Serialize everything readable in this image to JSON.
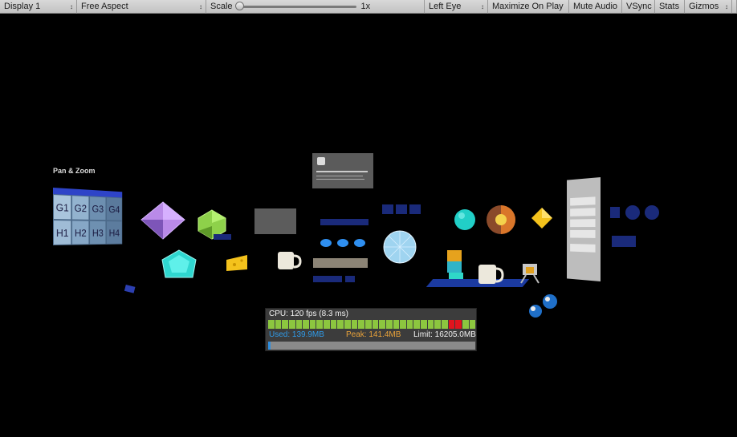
{
  "toolbar": {
    "display": "Display 1",
    "aspect": "Free Aspect",
    "scale_label": "Scale",
    "scale_value": "1x",
    "eye": "Left Eye",
    "maximize": "Maximize On Play",
    "mute": "Mute Audio",
    "vsync": "VSync",
    "stats": "Stats",
    "gizmos": "Gizmos",
    "dropdown_arrow": "↕"
  },
  "scene": {
    "pan_zoom_title": "Pan & Zoom",
    "grid_cells": [
      "G1",
      "G2",
      "G3",
      "G4",
      "H1",
      "H2",
      "H3",
      "H4"
    ]
  },
  "profiler": {
    "cpu": "CPU: 120 fps (8.3 ms)",
    "used": "Used: 139.9MB",
    "peak": "Peak: 141.4MB",
    "limit": "Limit: 16205.0MB",
    "colors": {
      "used": "#2f9ae8",
      "peak": "#e8a23a",
      "limit": "#f2f2f2",
      "bar_ok": "#8cc63f",
      "bar_hot": "#e0141e"
    }
  }
}
